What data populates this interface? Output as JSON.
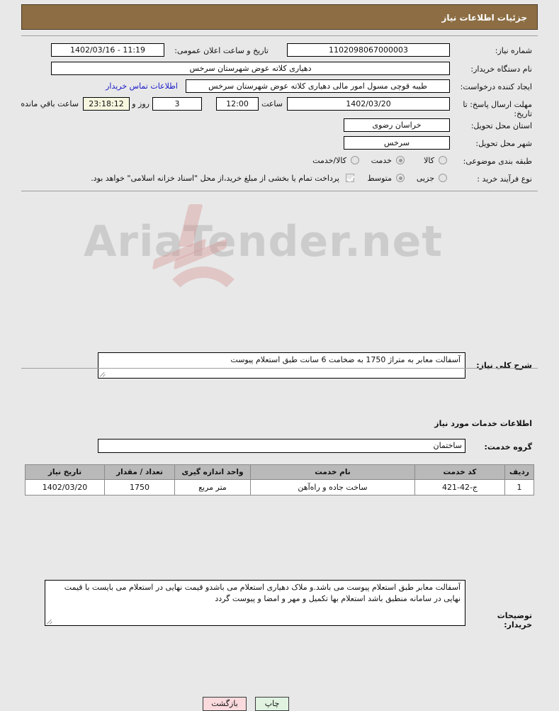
{
  "header": {
    "title": "جزئیات اطلاعات نیاز"
  },
  "fields": {
    "need_number": {
      "label": "شماره نیاز:",
      "value": "1102098067000003"
    },
    "public_announce": {
      "label": "تاریخ و ساعت اعلان عمومی:",
      "value": "11:19 - 1402/03/16"
    },
    "buyer_org": {
      "label": "نام دستگاه خریدار:",
      "value": "دهیاری کلاته عوض شهرستان سرخس"
    },
    "request_creator": {
      "label": "ایجاد کننده درخواست:",
      "value": "طیبه قوچی مسول امور مالی دهیاری کلاته عوض شهرستان سرخس"
    },
    "contact_link": {
      "label": "اطلاعات تماس خریدار"
    },
    "deadline": {
      "label": "مهلت ارسال پاسخ: تا تاریخ:",
      "date": "1402/03/20",
      "time_label": "ساعت",
      "time": "12:00",
      "days": "3",
      "days_label": "روز و",
      "remaining": "23:18:12",
      "remaining_label": "ساعت باقي مانده"
    },
    "province": {
      "label": "استان محل تحویل:",
      "value": "خراسان رضوی"
    },
    "city": {
      "label": "شهر محل تحویل:",
      "value": "سرخس"
    },
    "subject_class": {
      "label": "طبقه بندی موضوعی:",
      "options": [
        {
          "label": "کالا",
          "selected": false
        },
        {
          "label": "خدمت",
          "selected": true
        },
        {
          "label": "کالا/خدمت",
          "selected": false
        }
      ]
    },
    "purchase_type": {
      "label": "نوع فرآیند خرید :",
      "options": [
        {
          "label": "جزیی",
          "selected": false
        },
        {
          "label": "متوسط",
          "selected": true
        }
      ],
      "treasury_checkbox_checked": true,
      "treasury_note": "پرداخت تمام یا بخشی از مبلغ خرید،از محل \"اسناد خزانه اسلامی\" خواهد بود."
    },
    "general_desc": {
      "label": "شرح کلی نیاز:",
      "value": "آسفالت معابر به متراژ 1750 به ضخامت 6 سانت طبق استعلام پیوست"
    },
    "services_section_title": "اطلاعات خدمات مورد نیاز",
    "service_group": {
      "label": "گروه خدمت:",
      "value": "ساختمان"
    },
    "buyer_notes": {
      "label": "توضیحات خریدار:",
      "value": "آسفالت معابر طبق استعلام  پیوست می باشد.و ملاک  دهیاری استعلام  می باشدو قیمت نهایی در استعلام می بایست با قیمت  نهایی در سامانه  منطبق باشد استعلام  بها  تکمیل  و مهر و امضا و پیوست  گردد"
    }
  },
  "table": {
    "columns": [
      "ردیف",
      "کد خدمت",
      "نام خدمت",
      "واحد اندازه گیری",
      "تعداد / مقدار",
      "تاریخ نیاز"
    ],
    "rows": [
      {
        "row_no": "1",
        "service_code": "ج-42-421",
        "service_name": "ساخت جاده و راه‌آهن",
        "unit": "متر مربع",
        "quantity": "1750",
        "need_date": "1402/03/20"
      }
    ]
  },
  "footer": {
    "print_label": "چاپ",
    "back_label": "بازگشت"
  },
  "watermark": {
    "text": "AriaTender.net"
  },
  "colors": {
    "header_bg": "#8d6e44",
    "page_bg": "#e8e8e8",
    "link": "#1818c8",
    "table_header_bg": "#b9b9b9",
    "print_btn": "#e0f2e0",
    "back_btn": "#fadadd",
    "highlight_field": "#f7f7e0"
  }
}
